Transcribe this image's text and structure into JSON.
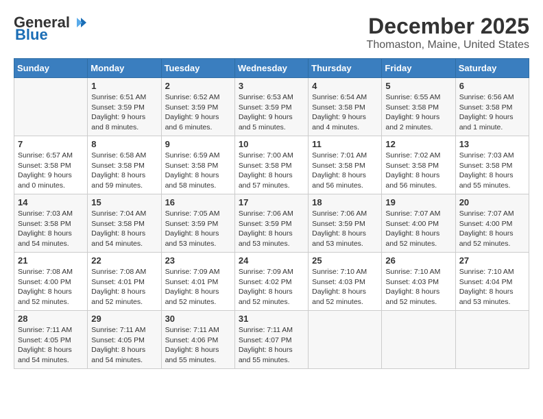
{
  "logo": {
    "line1": "General",
    "line2": "Blue"
  },
  "title": "December 2025",
  "location": "Thomaston, Maine, United States",
  "days_header": [
    "Sunday",
    "Monday",
    "Tuesday",
    "Wednesday",
    "Thursday",
    "Friday",
    "Saturday"
  ],
  "weeks": [
    [
      {
        "day": "",
        "info": ""
      },
      {
        "day": "1",
        "info": "Sunrise: 6:51 AM\nSunset: 3:59 PM\nDaylight: 9 hours\nand 8 minutes."
      },
      {
        "day": "2",
        "info": "Sunrise: 6:52 AM\nSunset: 3:59 PM\nDaylight: 9 hours\nand 6 minutes."
      },
      {
        "day": "3",
        "info": "Sunrise: 6:53 AM\nSunset: 3:59 PM\nDaylight: 9 hours\nand 5 minutes."
      },
      {
        "day": "4",
        "info": "Sunrise: 6:54 AM\nSunset: 3:58 PM\nDaylight: 9 hours\nand 4 minutes."
      },
      {
        "day": "5",
        "info": "Sunrise: 6:55 AM\nSunset: 3:58 PM\nDaylight: 9 hours\nand 2 minutes."
      },
      {
        "day": "6",
        "info": "Sunrise: 6:56 AM\nSunset: 3:58 PM\nDaylight: 9 hours\nand 1 minute."
      }
    ],
    [
      {
        "day": "7",
        "info": "Sunrise: 6:57 AM\nSunset: 3:58 PM\nDaylight: 9 hours\nand 0 minutes."
      },
      {
        "day": "8",
        "info": "Sunrise: 6:58 AM\nSunset: 3:58 PM\nDaylight: 8 hours\nand 59 minutes."
      },
      {
        "day": "9",
        "info": "Sunrise: 6:59 AM\nSunset: 3:58 PM\nDaylight: 8 hours\nand 58 minutes."
      },
      {
        "day": "10",
        "info": "Sunrise: 7:00 AM\nSunset: 3:58 PM\nDaylight: 8 hours\nand 57 minutes."
      },
      {
        "day": "11",
        "info": "Sunrise: 7:01 AM\nSunset: 3:58 PM\nDaylight: 8 hours\nand 56 minutes."
      },
      {
        "day": "12",
        "info": "Sunrise: 7:02 AM\nSunset: 3:58 PM\nDaylight: 8 hours\nand 56 minutes."
      },
      {
        "day": "13",
        "info": "Sunrise: 7:03 AM\nSunset: 3:58 PM\nDaylight: 8 hours\nand 55 minutes."
      }
    ],
    [
      {
        "day": "14",
        "info": "Sunrise: 7:03 AM\nSunset: 3:58 PM\nDaylight: 8 hours\nand 54 minutes."
      },
      {
        "day": "15",
        "info": "Sunrise: 7:04 AM\nSunset: 3:58 PM\nDaylight: 8 hours\nand 54 minutes."
      },
      {
        "day": "16",
        "info": "Sunrise: 7:05 AM\nSunset: 3:59 PM\nDaylight: 8 hours\nand 53 minutes."
      },
      {
        "day": "17",
        "info": "Sunrise: 7:06 AM\nSunset: 3:59 PM\nDaylight: 8 hours\nand 53 minutes."
      },
      {
        "day": "18",
        "info": "Sunrise: 7:06 AM\nSunset: 3:59 PM\nDaylight: 8 hours\nand 53 minutes."
      },
      {
        "day": "19",
        "info": "Sunrise: 7:07 AM\nSunset: 4:00 PM\nDaylight: 8 hours\nand 52 minutes."
      },
      {
        "day": "20",
        "info": "Sunrise: 7:07 AM\nSunset: 4:00 PM\nDaylight: 8 hours\nand 52 minutes."
      }
    ],
    [
      {
        "day": "21",
        "info": "Sunrise: 7:08 AM\nSunset: 4:00 PM\nDaylight: 8 hours\nand 52 minutes."
      },
      {
        "day": "22",
        "info": "Sunrise: 7:08 AM\nSunset: 4:01 PM\nDaylight: 8 hours\nand 52 minutes."
      },
      {
        "day": "23",
        "info": "Sunrise: 7:09 AM\nSunset: 4:01 PM\nDaylight: 8 hours\nand 52 minutes."
      },
      {
        "day": "24",
        "info": "Sunrise: 7:09 AM\nSunset: 4:02 PM\nDaylight: 8 hours\nand 52 minutes."
      },
      {
        "day": "25",
        "info": "Sunrise: 7:10 AM\nSunset: 4:03 PM\nDaylight: 8 hours\nand 52 minutes."
      },
      {
        "day": "26",
        "info": "Sunrise: 7:10 AM\nSunset: 4:03 PM\nDaylight: 8 hours\nand 52 minutes."
      },
      {
        "day": "27",
        "info": "Sunrise: 7:10 AM\nSunset: 4:04 PM\nDaylight: 8 hours\nand 53 minutes."
      }
    ],
    [
      {
        "day": "28",
        "info": "Sunrise: 7:11 AM\nSunset: 4:05 PM\nDaylight: 8 hours\nand 54 minutes."
      },
      {
        "day": "29",
        "info": "Sunrise: 7:11 AM\nSunset: 4:05 PM\nDaylight: 8 hours\nand 54 minutes."
      },
      {
        "day": "30",
        "info": "Sunrise: 7:11 AM\nSunset: 4:06 PM\nDaylight: 8 hours\nand 55 minutes."
      },
      {
        "day": "31",
        "info": "Sunrise: 7:11 AM\nSunset: 4:07 PM\nDaylight: 8 hours\nand 55 minutes."
      },
      {
        "day": "",
        "info": ""
      },
      {
        "day": "",
        "info": ""
      },
      {
        "day": "",
        "info": ""
      }
    ]
  ]
}
